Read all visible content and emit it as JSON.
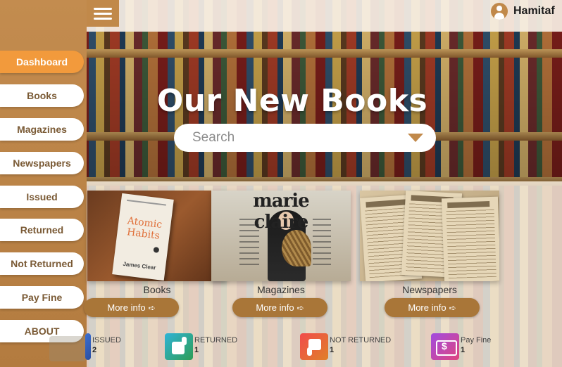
{
  "user": {
    "name": "Hamitaf"
  },
  "sidebar": {
    "items": [
      {
        "label": "Dashboard",
        "active": true
      },
      {
        "label": "Books"
      },
      {
        "label": "Magazines"
      },
      {
        "label": "Newspapers"
      },
      {
        "label": "Issued"
      },
      {
        "label": "Returned"
      },
      {
        "label": "Not Returned"
      },
      {
        "label": "Pay Fine"
      },
      {
        "label": "ABOUT"
      }
    ]
  },
  "hero": {
    "title": "Our New Books",
    "search_placeholder": "Search"
  },
  "cards": [
    {
      "label": "Books",
      "button": "More info",
      "cover_title": "Atomic Habits",
      "cover_author": "James Clear"
    },
    {
      "label": "Magazines",
      "button": "More info",
      "masthead": "marie claire"
    },
    {
      "label": "Newspapers",
      "button": "More info"
    }
  ],
  "stats": [
    {
      "label": "ISSUED",
      "value": "2"
    },
    {
      "label": "RETURNED",
      "value": "1"
    },
    {
      "label": "NOT RETURNED",
      "value": "1"
    },
    {
      "label": "Pay Fine",
      "value": "1"
    }
  ],
  "colors": {
    "sidebar": "#c38c4f",
    "active": "#f29a3c",
    "button": "#a97638"
  },
  "icons": [
    "menu-icon",
    "user-icon",
    "dropdown-caret-icon",
    "arrow-right-icon",
    "issued-icon",
    "thumbs-up-icon",
    "thumbs-down-icon",
    "money-icon"
  ]
}
